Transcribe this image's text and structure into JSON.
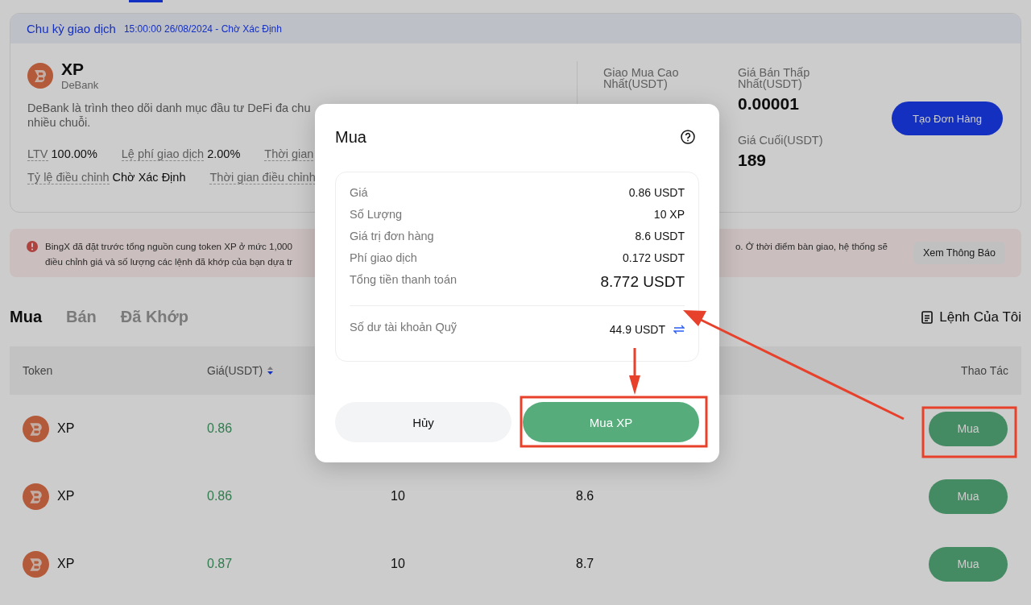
{
  "cycle": {
    "label": "Chu kỳ giao dịch",
    "value": "15:00:00 26/08/2024 - Chờ Xác Định"
  },
  "token": {
    "symbol": "XP",
    "name": "DeBank",
    "description_lines": [
      "DeBank là trình theo dõi danh mục đầu tư DeFi đa chu",
      "nhiều chuỗi."
    ]
  },
  "stats_rows": [
    [
      {
        "label": "LTV",
        "value": "100.00%"
      },
      {
        "label": "Lệ phí giao dịch",
        "value": "2.00%"
      },
      {
        "label": "Thời gian"
      }
    ],
    [
      {
        "label": "Tỷ lệ điều chỉnh",
        "value": "Chờ Xác Định"
      },
      {
        "label": "Thời gian điều chỉnh"
      }
    ]
  ],
  "market_columns": [
    [
      {
        "label": "Giao Mua Cao Nhất(USDT)"
      }
    ],
    [
      {
        "label": "Giá Bán Thấp Nhất(USDT)",
        "value": "0.00001"
      },
      {
        "label": "Giá Cuối(USDT)",
        "value": "189"
      }
    ]
  ],
  "create_order_button": "Tạo Đơn Hàng",
  "notice": {
    "line1_start": "BingX đã đặt trước tổng nguồn cung token XP ở mức 1,000",
    "line1_end": "o. Ở thời điểm bàn giao, hệ thống sẽ",
    "line2_start": "điều chỉnh giá và số lượng các lệnh đã khớp của bạn dựa tr",
    "button": "Xem Thông Báo"
  },
  "tabs": [
    {
      "label": "Mua",
      "selected": true
    },
    {
      "label": "Bán",
      "selected": false
    },
    {
      "label": "Đã Khớp",
      "selected": false
    }
  ],
  "my_orders": "Lệnh Của Tôi",
  "table": {
    "columns": [
      "Token",
      "Giá(USDT)",
      "Thao Tác"
    ],
    "rows": [
      {
        "token": "XP",
        "price": "0.86",
        "action": "Mua"
      },
      {
        "token": "XP",
        "price": "0.86",
        "quantity": "10",
        "total": "8.6",
        "action": "Mua"
      },
      {
        "token": "XP",
        "price": "0.87",
        "quantity": "10",
        "total": "8.7",
        "action": "Mua"
      }
    ]
  },
  "dialog": {
    "title": "Mua",
    "rows": [
      {
        "kind": "normal",
        "label": "Giá",
        "value": "0.86 USDT"
      },
      {
        "kind": "normal",
        "label": "Số Lượng",
        "value": "10 XP"
      },
      {
        "kind": "normal",
        "label": "Giá trị đơn hàng",
        "value": "8.6 USDT"
      },
      {
        "kind": "normal",
        "label": "Phí giao dịch",
        "value": "0.172 USDT"
      },
      {
        "kind": "total",
        "label": "Tổng tiền thanh toán",
        "value": "8.772 USDT"
      }
    ],
    "balance": {
      "label": "Số dư tài khoản Quỹ",
      "value": "44.9 USDT"
    },
    "cancel": "Hủy",
    "confirm": "Mua XP"
  }
}
